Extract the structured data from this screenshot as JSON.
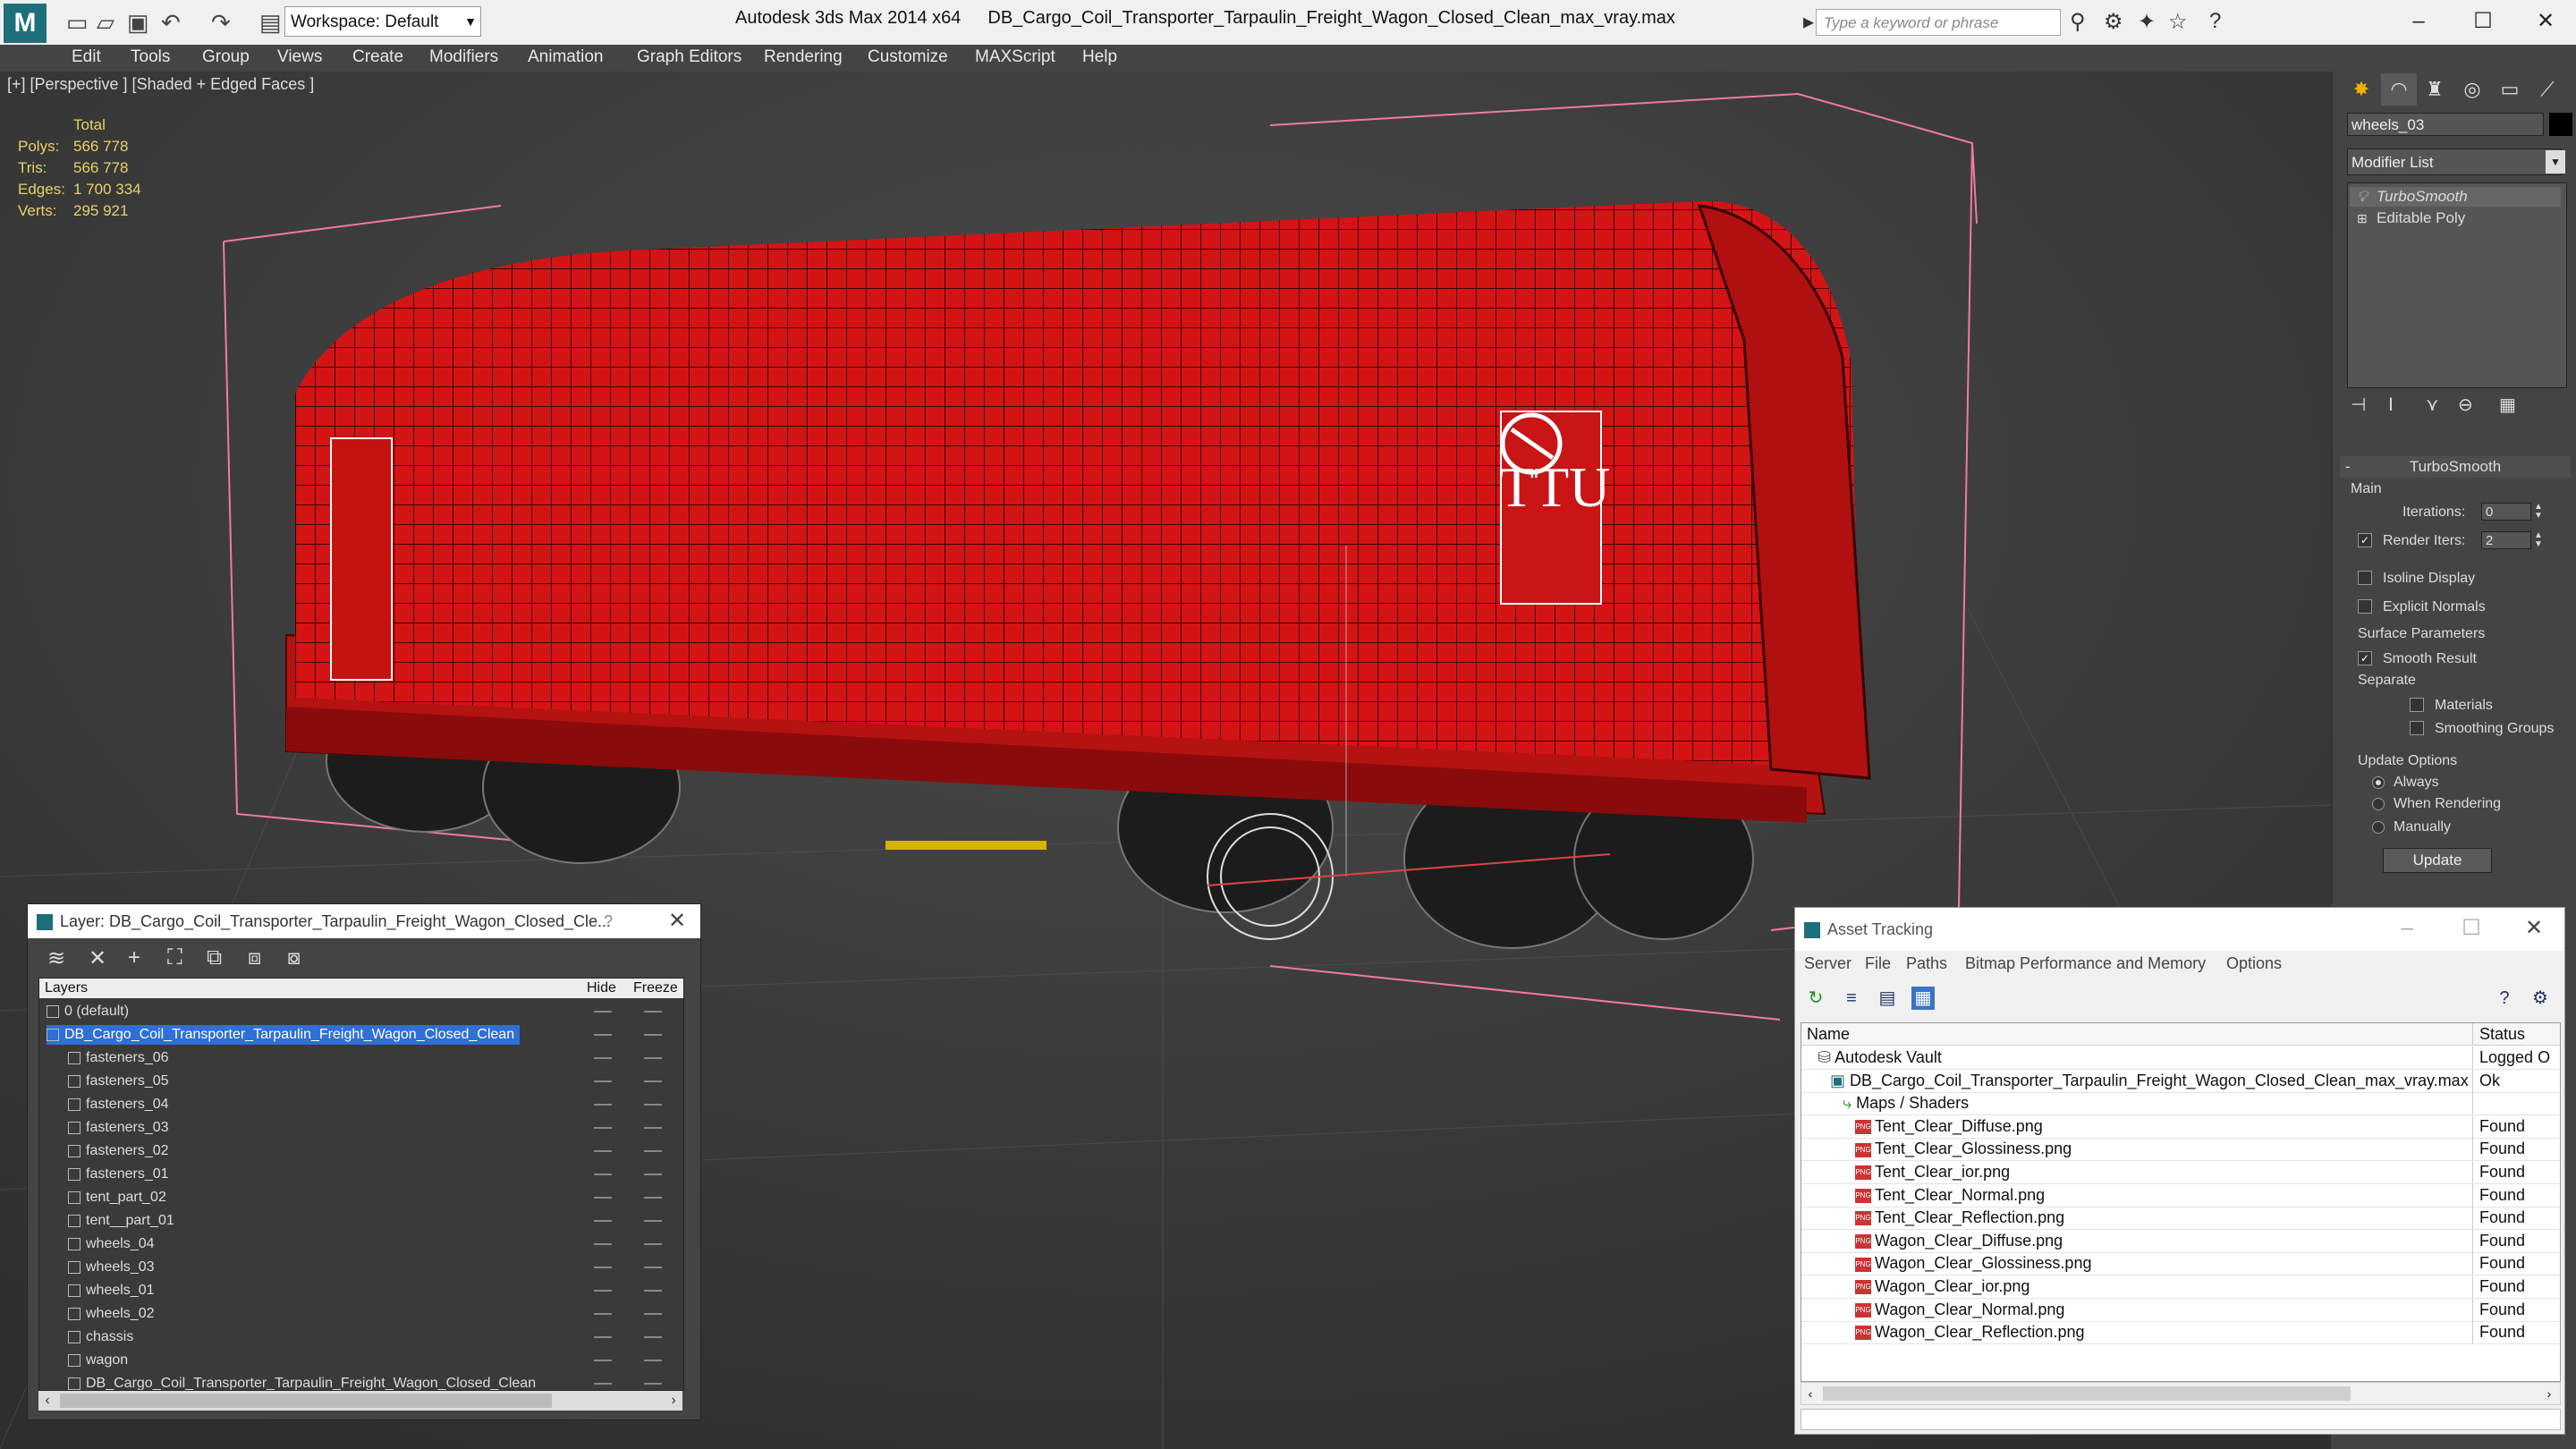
{
  "titlebar": {
    "workspace": "Workspace: Default",
    "app_name": "Autodesk 3ds Max  2014 x64",
    "file_name": "DB_Cargo_Coil_Transporter_Tarpaulin_Freight_Wagon_Closed_Clean_max_vray.max",
    "search_placeholder": "Type a keyword or phrase"
  },
  "menu": [
    "Edit",
    "Tools",
    "Group",
    "Views",
    "Create",
    "Modifiers",
    "Animation",
    "Graph Editors",
    "Rendering",
    "Customize",
    "MAXScript",
    "Help"
  ],
  "viewport": {
    "label": "[+] [Perspective ] [Shaded + Edged Faces ]",
    "stats": {
      "header": "Total",
      "rows": [
        {
          "k": "Polys:",
          "v": "566 778"
        },
        {
          "k": "Tris:",
          "v": "566 778"
        },
        {
          "k": "Edges:",
          "v": "1 700 334"
        },
        {
          "k": "Verts:",
          "v": "295 921"
        }
      ]
    },
    "wagon_logo_text": "TTU"
  },
  "command_panel": {
    "object_name": "wheels_03",
    "modifier_list": "Modifier List",
    "stack": [
      "TurboSmooth",
      "Editable Poly"
    ],
    "rollout_title": "TurboSmooth",
    "main_label": "Main",
    "iterations_label": "Iterations:",
    "iterations_value": "0",
    "render_iters_label": "Render Iters:",
    "render_iters_value": "2",
    "isoline": "Isoline Display",
    "explicit": "Explicit Normals",
    "surface_params": "Surface Parameters",
    "smooth_result": "Smooth Result",
    "separate": "Separate",
    "materials": "Materials",
    "smoothing_groups": "Smoothing Groups",
    "update_options": "Update Options",
    "always": "Always",
    "when_rendering": "When Rendering",
    "manually": "Manually",
    "update_btn": "Update"
  },
  "layer_window": {
    "title": "Layer: DB_Cargo_Coil_Transporter_Tarpaulin_Freight_Wagon_Closed_Cle...",
    "help": "?",
    "col_layers": "Layers",
    "col_hide": "Hide",
    "col_freeze": "Freeze",
    "rows": [
      {
        "name": "0 (default)",
        "indent": 0
      },
      {
        "name": "DB_Cargo_Coil_Transporter_Tarpaulin_Freight_Wagon_Closed_Clean",
        "indent": 0,
        "selected": true
      },
      {
        "name": "fasteners_06",
        "indent": 1
      },
      {
        "name": "fasteners_05",
        "indent": 1
      },
      {
        "name": "fasteners_04",
        "indent": 1
      },
      {
        "name": "fasteners_03",
        "indent": 1
      },
      {
        "name": "fasteners_02",
        "indent": 1
      },
      {
        "name": "fasteners_01",
        "indent": 1
      },
      {
        "name": "tent_part_02",
        "indent": 1
      },
      {
        "name": "tent__part_01",
        "indent": 1
      },
      {
        "name": "wheels_04",
        "indent": 1
      },
      {
        "name": "wheels_03",
        "indent": 1
      },
      {
        "name": "wheels_01",
        "indent": 1
      },
      {
        "name": "wheels_02",
        "indent": 1
      },
      {
        "name": "chassis",
        "indent": 1
      },
      {
        "name": "wagon",
        "indent": 1
      },
      {
        "name": "DB_Cargo_Coil_Transporter_Tarpaulin_Freight_Wagon_Closed_Clean",
        "indent": 1
      }
    ]
  },
  "asset_window": {
    "title": "Asset Tracking",
    "menu": [
      "Server",
      "File",
      "Paths",
      "Bitmap Performance and Memory",
      "Options"
    ],
    "col_name": "Name",
    "col_status": "Status",
    "rows": [
      {
        "name": "Autodesk Vault",
        "status": "Logged O",
        "level": 0,
        "kind": "vault"
      },
      {
        "name": "DB_Cargo_Coil_Transporter_Tarpaulin_Freight_Wagon_Closed_Clean_max_vray.max",
        "status": "Ok",
        "level": 1,
        "kind": "max"
      },
      {
        "name": "Maps / Shaders",
        "status": "",
        "level": 2,
        "kind": "folder"
      },
      {
        "name": "Tent_Clear_Diffuse.png",
        "status": "Found",
        "level": 3,
        "kind": "png"
      },
      {
        "name": "Tent_Clear_Glossiness.png",
        "status": "Found",
        "level": 3,
        "kind": "png"
      },
      {
        "name": "Tent_Clear_ior.png",
        "status": "Found",
        "level": 3,
        "kind": "png"
      },
      {
        "name": "Tent_Clear_Normal.png",
        "status": "Found",
        "level": 3,
        "kind": "png"
      },
      {
        "name": "Tent_Clear_Reflection.png",
        "status": "Found",
        "level": 3,
        "kind": "png"
      },
      {
        "name": "Wagon_Clear_Diffuse.png",
        "status": "Found",
        "level": 3,
        "kind": "png"
      },
      {
        "name": "Wagon_Clear_Glossiness.png",
        "status": "Found",
        "level": 3,
        "kind": "png"
      },
      {
        "name": "Wagon_Clear_ior.png",
        "status": "Found",
        "level": 3,
        "kind": "png"
      },
      {
        "name": "Wagon_Clear_Normal.png",
        "status": "Found",
        "level": 3,
        "kind": "png"
      },
      {
        "name": "Wagon_Clear_Reflection.png",
        "status": "Found",
        "level": 3,
        "kind": "png"
      }
    ]
  }
}
